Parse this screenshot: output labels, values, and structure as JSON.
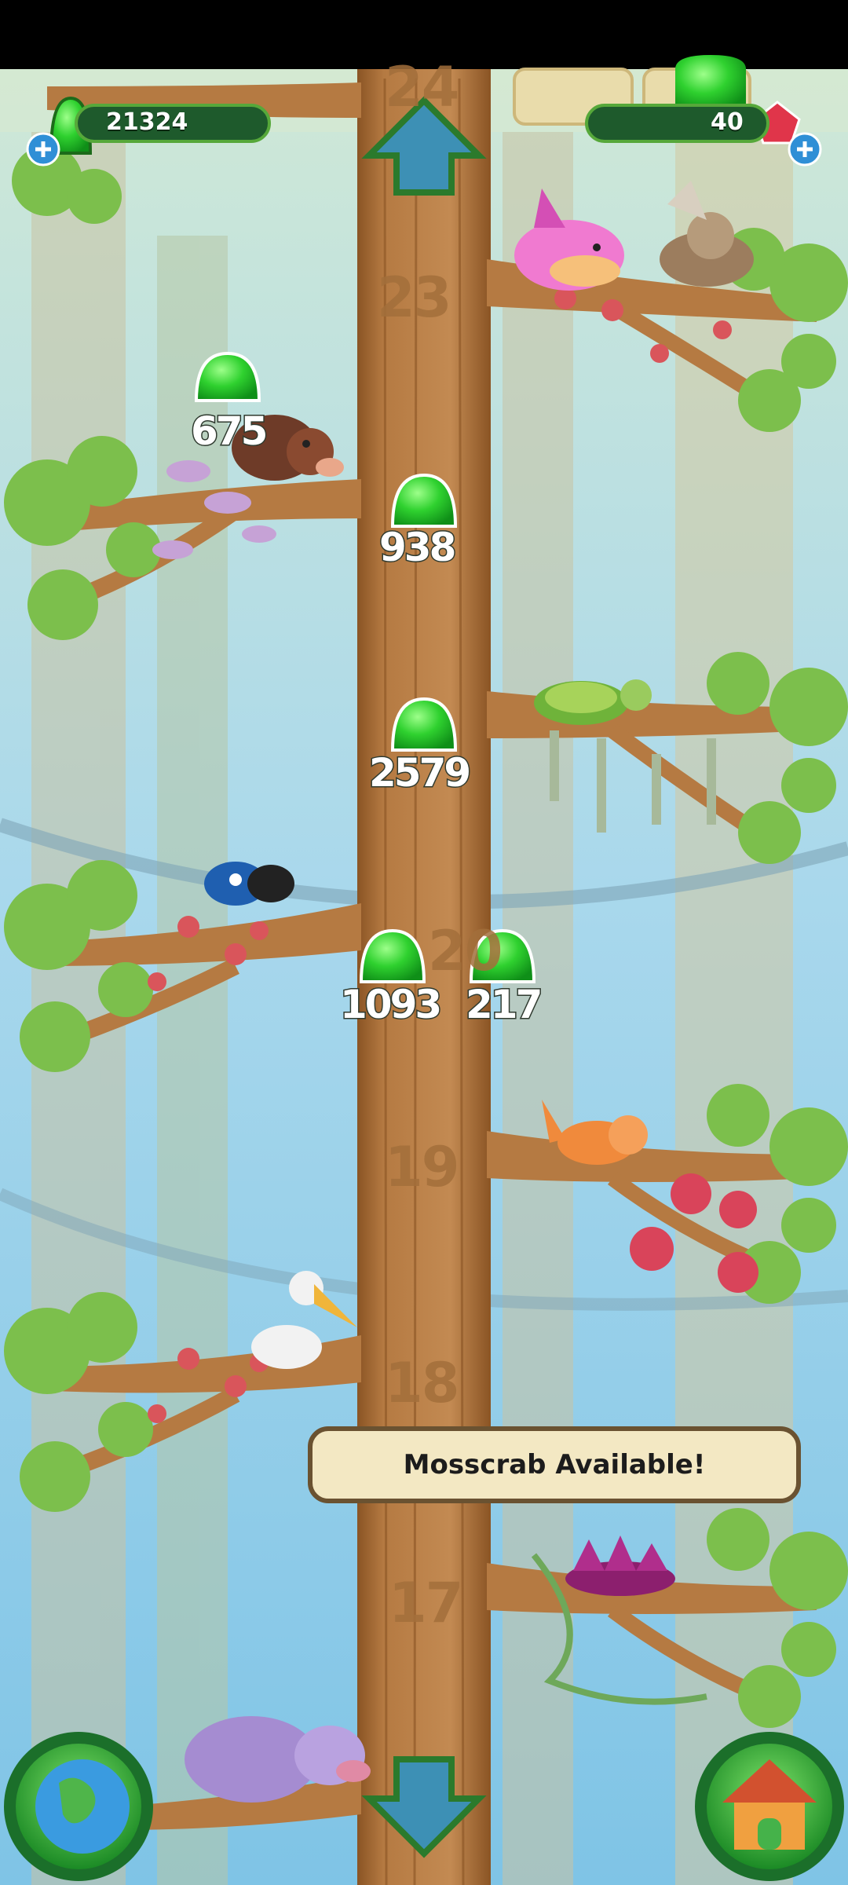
{
  "hud": {
    "goo_count": "21324",
    "gem_count": "40"
  },
  "goo_collect": [
    {
      "label": "675"
    },
    {
      "label": "938"
    },
    {
      "label": "2579"
    },
    {
      "label": "1093"
    },
    {
      "label": "217"
    }
  ],
  "floors": {
    "f24": "24",
    "f23": "23",
    "f20": "20",
    "f19": "19",
    "f18": "18",
    "f17": "17"
  },
  "notice": {
    "text": "Mosscrab Available!"
  },
  "colors": {
    "sky": "#a9d8ec",
    "trunk": "#b57a42",
    "goo": "#2fd12f",
    "hud_bar": "#1e5a2c",
    "notice_bg": "#f3e8c3"
  },
  "icons": {
    "up": "arrow-up-icon",
    "down": "arrow-down-icon",
    "map": "globe-icon",
    "home": "house-icon"
  }
}
